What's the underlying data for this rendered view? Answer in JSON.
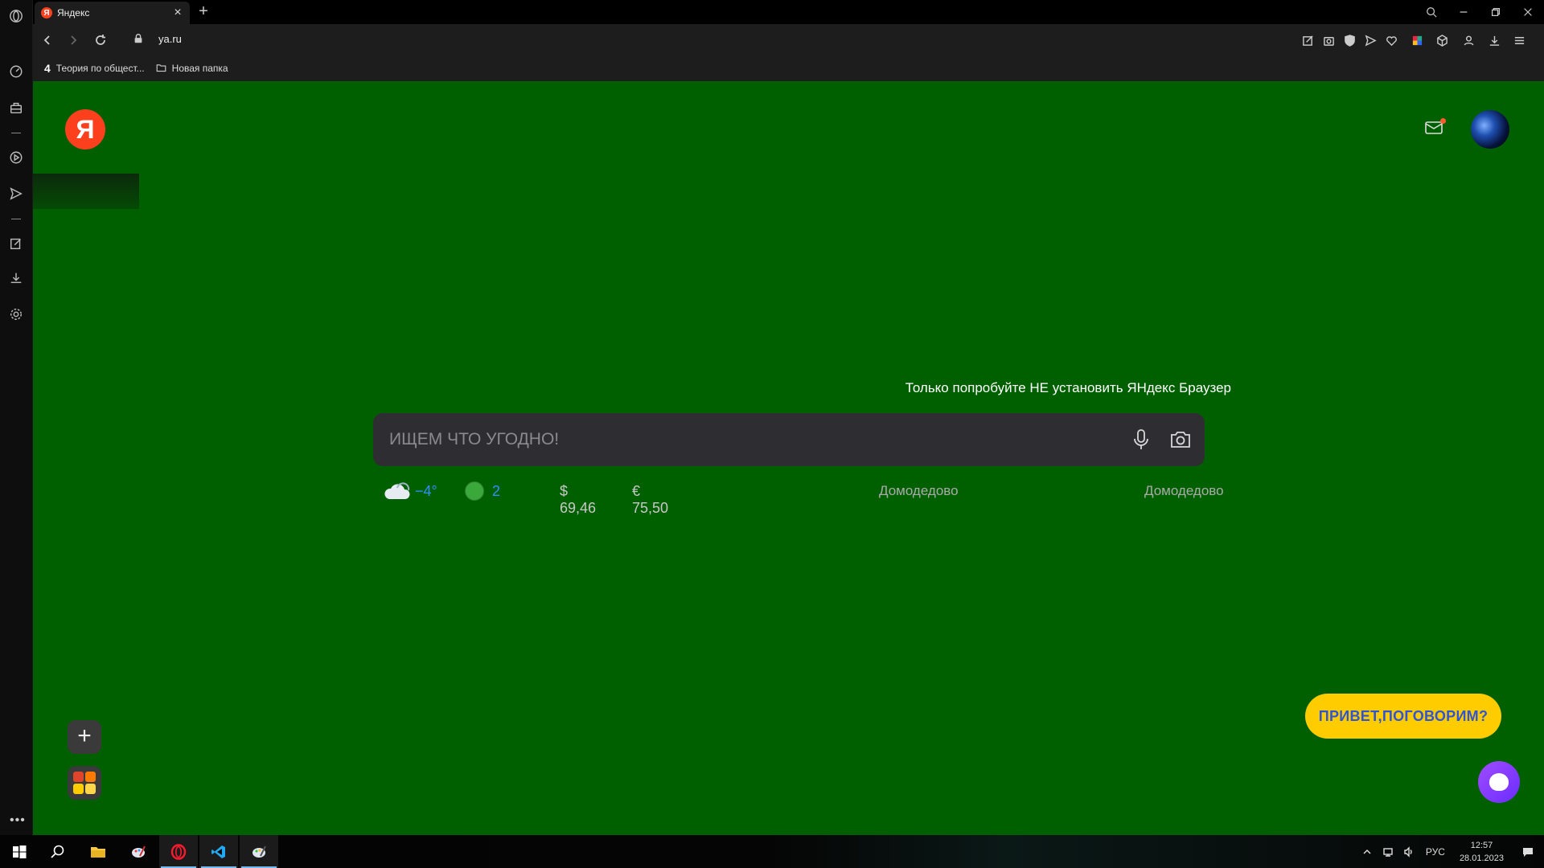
{
  "tab": {
    "title": "Яндекс",
    "favicon": "Я"
  },
  "address": {
    "url": "ya.ru"
  },
  "bookmarks": [
    {
      "num": "4",
      "label": "Теория по общест..."
    },
    {
      "label": "Новая папка"
    }
  ],
  "page": {
    "logo": "Я",
    "promo": "Только попробуйте НЕ установить ЯНдекс Браузер",
    "search": {
      "placeholder": "ИЩЕМ ЧТО УГОДНО!"
    },
    "weather": {
      "temp": "−4°"
    },
    "traffic": {
      "level": "2"
    },
    "currency": {
      "usd": "$ 69,46",
      "eur": "€ 75,50"
    },
    "location1": "Домодедово",
    "location2": "Домодедово",
    "alice": {
      "bubble": "ПРИВЕТ,ПОГОВОРИМ?"
    },
    "add_label": "+"
  },
  "taskbar": {
    "lang": "РУС",
    "time": "12:57",
    "date": "28.01.2023"
  },
  "colors": {
    "page_bg": "#006000",
    "yandex_red": "#fc3f1d",
    "alice_yellow": "#ffcc00",
    "alice_purple": "#8a3cff",
    "link_blue": "#2e8fff"
  }
}
